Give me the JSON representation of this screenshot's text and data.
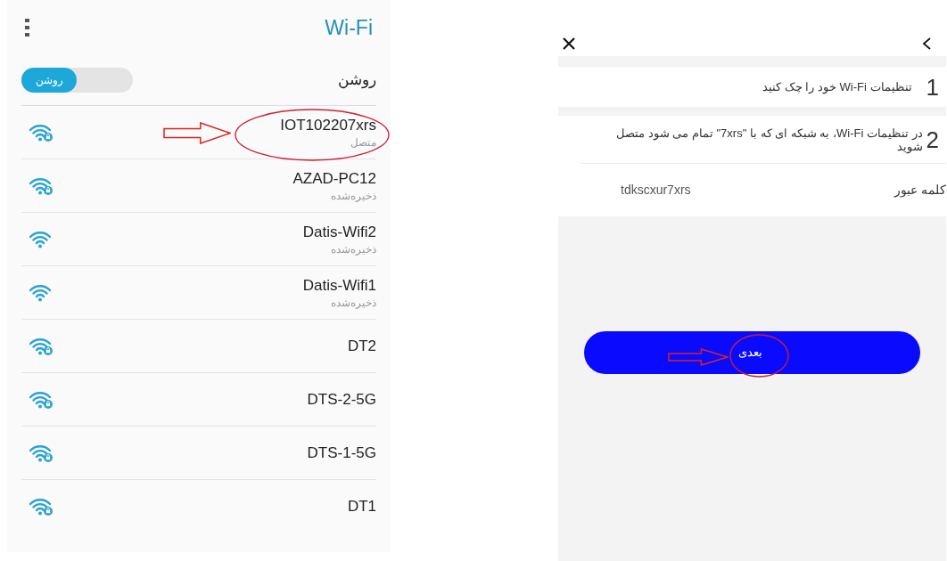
{
  "wifi_screen": {
    "title": "Wi-Fi",
    "toggle": {
      "label": "روشن",
      "thumb_label": "روشن",
      "on": true
    },
    "networks": [
      {
        "name": "IOT102207xrs",
        "status": "متصل",
        "locked": true
      },
      {
        "name": "AZAD-PC12",
        "status": "ذخیره‌شده",
        "locked": true
      },
      {
        "name": "Datis-Wifi2",
        "status": "ذخیره‌شده",
        "locked": false
      },
      {
        "name": "Datis-Wifi1",
        "status": "ذخیره‌شده",
        "locked": false
      },
      {
        "name": "DT2",
        "locked": true
      },
      {
        "name": "DTS-2-5G",
        "locked": true
      },
      {
        "name": "DTS-1-5G",
        "locked": true
      },
      {
        "name": "DT1",
        "locked": true
      }
    ]
  },
  "setup_screen": {
    "steps": [
      {
        "number": "1",
        "text": "تنظیمات Wi-Fi خود را چک کنید"
      },
      {
        "number": "2",
        "text": "در تنظیمات Wi-Fi، به شبکه ای که با \"7xrs\" تمام می شود متصل شوید",
        "password_label": "کلمه عبور",
        "password": "tdkscxur7xrs"
      }
    ],
    "next_button": "بعدی"
  }
}
